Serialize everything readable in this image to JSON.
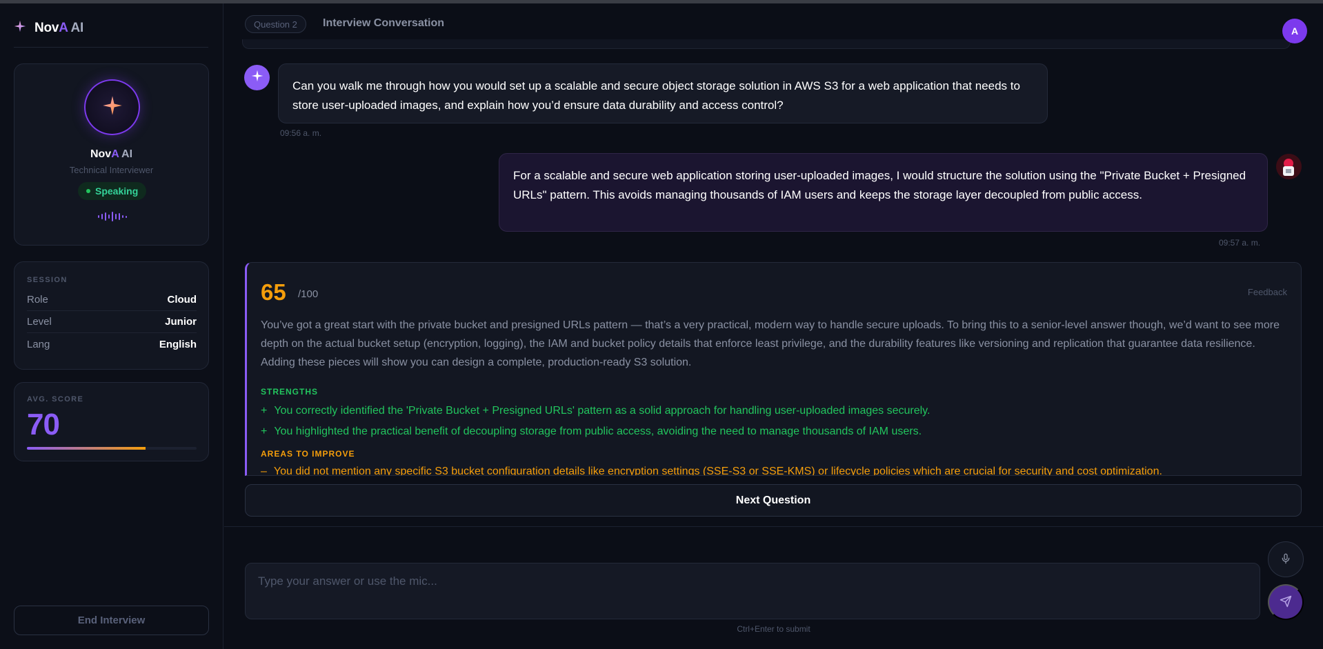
{
  "brand": {
    "name_prefix": "Nov",
    "name_accent": "A",
    "name_suffix": " AI"
  },
  "profile": {
    "name_prefix": "Nov",
    "name_accent": "A",
    "name_suffix": " AI",
    "role": "Technical Interviewer",
    "status": "Speaking"
  },
  "session": {
    "label": "SESSION",
    "rows": [
      {
        "key": "Role",
        "value": "Cloud"
      },
      {
        "key": "Level",
        "value": "Junior"
      },
      {
        "key": "Lang",
        "value": "English"
      }
    ]
  },
  "avg_score": {
    "label": "AVG. SCORE",
    "value": "70",
    "progress_percent": 70
  },
  "end_button": "End Interview",
  "header": {
    "question_badge": "Question 2",
    "title": "Interview Conversation",
    "user_initial": "A"
  },
  "messages": {
    "ai": {
      "text": "Can you walk me through how you would set up a scalable and secure object storage solution in AWS S3 for a web application that needs to store user-uploaded images, and explain how you’d ensure data durability and access control?",
      "time": "09:56 a. m."
    },
    "user": {
      "text": "For a scalable and secure web application storing user-uploaded images, I would structure the solution using the \"Private Bucket + Presigned URLs\" pattern. This avoids managing thousands of IAM users and keeps the storage layer decoupled from public access.",
      "time": "09:57 a. m."
    }
  },
  "feedback": {
    "score": "65",
    "max": "/100",
    "label": "Feedback",
    "summary": "You’ve got a great start with the private bucket and presigned URLs pattern — that’s a very practical, modern way to handle secure uploads. To bring this to a senior-level answer though, we’d want to see more depth on the actual bucket setup (encryption, logging), the IAM and bucket policy details that enforce least privilege, and the durability features like versioning and replication that guarantee data resilience. Adding these pieces will show you can design a complete, production-ready S3 solution.",
    "strengths_label": "STRENGTHS",
    "strengths": [
      "You correctly identified the 'Private Bucket + Presigned URLs' pattern as a solid approach for handling user-uploaded images securely.",
      "You highlighted the practical benefit of decoupling storage from public access, avoiding the need to manage thousands of IAM users."
    ],
    "improve_label": "AREAS TO IMPROVE",
    "improvements": [
      "You did not mention any specific S3 bucket configuration details like encryption settings (SSE-S3 or SSE-KMS) or lifecycle policies which are crucial for security and cost optimization."
    ],
    "strength_marker": "+",
    "improve_marker": "–"
  },
  "next_button": "Next Question",
  "input": {
    "placeholder": "Type your answer or use the mic...",
    "hint": "Ctrl+Enter to submit"
  },
  "colors": {
    "accent": "#8b5cf6",
    "score": "#f59e0b",
    "positive": "#22c55e",
    "background": "#0b0e17"
  },
  "icons": {
    "logo": "sparkle-icon",
    "mic": "microphone-icon",
    "send": "send-icon"
  }
}
